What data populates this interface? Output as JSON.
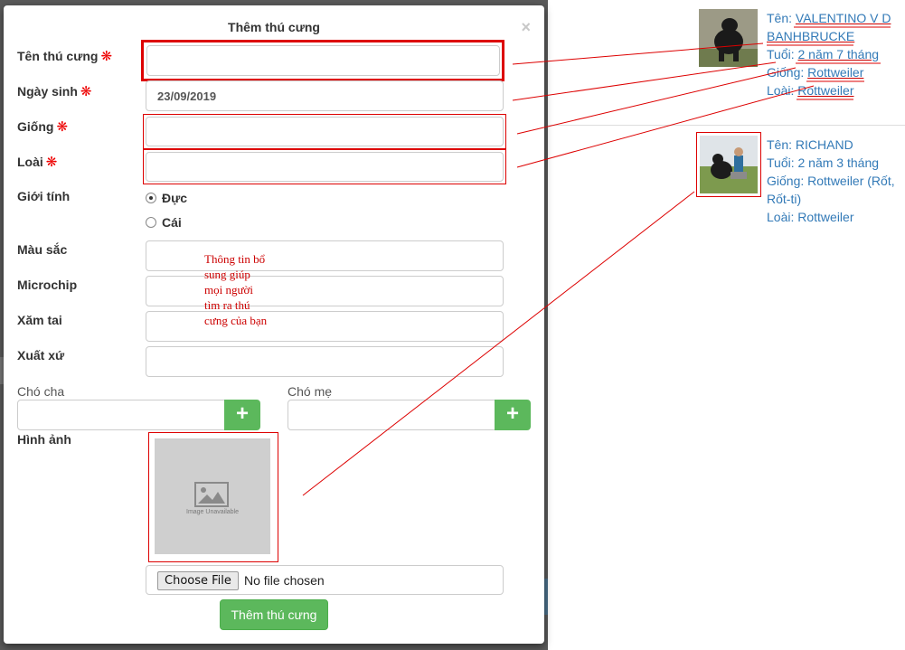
{
  "modal": {
    "title": "Thêm thú cưng",
    "close": "×",
    "required_mark": "❋",
    "fields": {
      "name_label": "Tên thú cưng",
      "dob_label": "Ngày sinh",
      "dob_value": "23/09/2019",
      "breed_label": "Giống",
      "species_label": "Loài",
      "gender_label": "Giới tính",
      "gender_male": "Đực",
      "gender_female": "Cái",
      "color_label": "Màu sắc",
      "microchip_label": "Microchip",
      "ear_tattoo_label": "Xăm tai",
      "origin_label": "Xuất xứ",
      "sire_label": "Chó cha",
      "dam_label": "Chó mẹ",
      "image_label": "Hình ảnh"
    },
    "plus": "+",
    "image_placeholder": "Image Unavailable",
    "file": {
      "button": "Choose File",
      "status": "No file chosen"
    },
    "submit": "Thêm thú cưng",
    "annotation": "Thông tin bổ sung giúp mọi người tìm ra thú cưng của bạn"
  },
  "pets": [
    {
      "name_label": "Tên:",
      "name": "VALENTINO V D",
      "name_cont": "BANHBRUCKE",
      "age_label": "Tuổi:",
      "age": "2 năm 7 tháng",
      "breed_label": "Giống:",
      "breed": "Rottweiler",
      "species_label": "Loài:",
      "species": "Rottweiler"
    },
    {
      "name_label": "Tên:",
      "name": "RICHAND",
      "age_label": "Tuổi:",
      "age": "2 năm 3 tháng",
      "breed_label": "Giống:",
      "breed": "Rottweiler (Rốt,",
      "breed_cont": "Rốt-ti)",
      "species_label": "Loài:",
      "species": "Rottweiler"
    }
  ],
  "colors": {
    "accent_green": "#5cb85c",
    "annotation_red": "#dd0000",
    "link_blue": "#337ab7"
  }
}
